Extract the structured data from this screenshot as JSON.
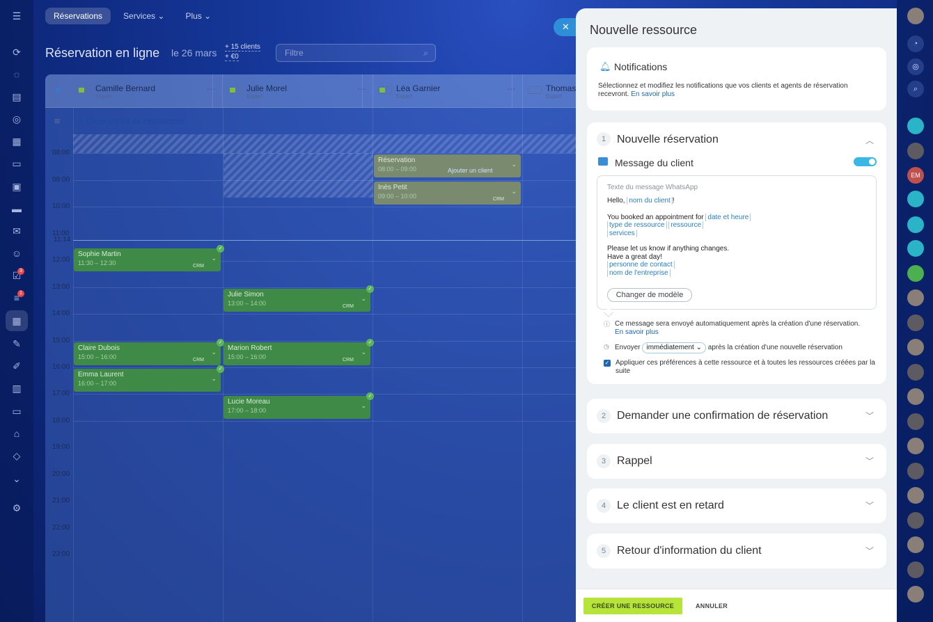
{
  "nav": {
    "tabs": [
      {
        "label": "Réservations"
      },
      {
        "label": "Services ⌄"
      },
      {
        "label": "Plus ⌄"
      }
    ]
  },
  "page": {
    "title": "Réservation en ligne",
    "date": "le 26 mars",
    "stat_clients": "+ 15 clients",
    "stat_revenue": "+ €0",
    "filter_placeholder": "Filtre"
  },
  "calendar": {
    "resources": [
      {
        "name": "Camille Bernard",
        "role": "Expert"
      },
      {
        "name": "Julie Morel",
        "role": "Expert"
      },
      {
        "name": "Léa Garnier",
        "role": "Expert"
      },
      {
        "name": "Thomas",
        "role": "Expert"
      }
    ],
    "create_batch": "+ Créer un lot de ressources",
    "hours": [
      "08:00",
      "09:00",
      "10:00",
      "11:00",
      "12:00",
      "13:00",
      "14:00",
      "15:00",
      "16:00",
      "17:00",
      "18:00",
      "19:00",
      "20:00",
      "21:00",
      "22:00",
      "23:00"
    ],
    "now_label": "11:14",
    "events": [
      {
        "title": "Réservation",
        "time": "08:00 – 09:00",
        "extra": "Ajouter un client"
      },
      {
        "title": "Inès Petit",
        "time": "09:00 – 10:00",
        "crm": "CRM"
      },
      {
        "title": "Sophie Martin",
        "time": "11:30 – 12:30",
        "crm": "CRM"
      },
      {
        "title": "Julie Simon",
        "time": "13:00 – 14:00",
        "crm": "CRM"
      },
      {
        "title": "Claire Dubois",
        "time": "15:00 – 16:00",
        "crm": "CRM"
      },
      {
        "title": "Marion Robert",
        "time": "15:00 – 16:00",
        "crm": "CRM"
      },
      {
        "title": "Emma Laurent",
        "time": "16:00 – 17:00"
      },
      {
        "title": "Lucie Moreau",
        "time": "17:00 – 18:00"
      }
    ]
  },
  "panel": {
    "title": "Nouvelle ressource",
    "notifications": {
      "title": "Notifications",
      "desc": "Sélectionnez et modifiez les notifications que vos clients et agents de réservation recevront.",
      "learn_more": "En savoir plus"
    },
    "section1": {
      "num": "1",
      "title": "Nouvelle réservation",
      "msg_title": "Message du client",
      "box_label": "Texte du message WhatsApp",
      "hello": "Hello, ",
      "tag_client": "nom du client",
      "excl": "!",
      "booked": "You booked an appointment for ",
      "tag_date": "date et heure",
      "tag_type": "type de ressource",
      "tag_resource": "ressource",
      "tag_services": "services",
      "line_changes": "Please let us know if anything changes.",
      "line_day": "Have a great day!",
      "tag_contact": "personne de contact",
      "tag_company": "nom de l'entreprise",
      "change_template": "Changer de modèle",
      "info1": "Ce message sera envoyé automatiquement après la création d'une réservation.",
      "info1_link": "En savoir plus",
      "send_prefix": "Envoyer",
      "send_value": "immédiatement ⌄",
      "send_suffix": "après la création d'une nouvelle réservation",
      "apply": "Appliquer ces préférences à cette ressource et à toutes les ressources créées par la suite"
    },
    "sections": [
      {
        "num": "2",
        "title": "Demander une confirmation de réservation"
      },
      {
        "num": "3",
        "title": "Rappel"
      },
      {
        "num": "4",
        "title": "Le client est en retard"
      },
      {
        "num": "5",
        "title": "Retour d'information du client"
      }
    ],
    "create_button": "CRÉER UNE RESSOURCE",
    "cancel_button": "ANNULER"
  },
  "badges": {
    "tasks": "3",
    "feed": "1"
  },
  "avatar_initials": "EM",
  "colors": {
    "accent": "#2e8fd8",
    "create": "#b7e43a",
    "event": "#3f8a46"
  }
}
